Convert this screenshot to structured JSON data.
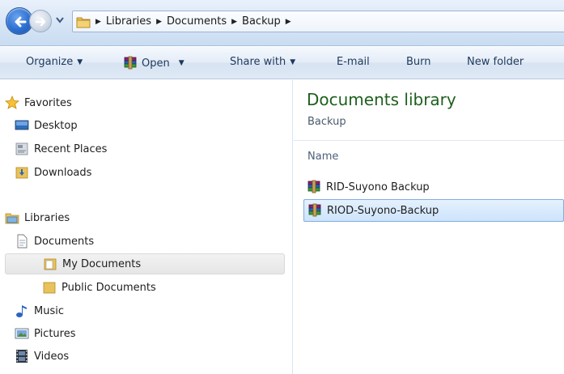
{
  "address": {
    "crumbs": [
      "Libraries",
      "Documents",
      "Backup"
    ]
  },
  "toolbar": {
    "organize": "Organize",
    "open": "Open",
    "share_with": "Share with",
    "email": "E-mail",
    "burn": "Burn",
    "new_folder": "New folder"
  },
  "nav": {
    "favorites": "Favorites",
    "desktop": "Desktop",
    "recent_places": "Recent Places",
    "downloads": "Downloads",
    "libraries": "Libraries",
    "documents": "Documents",
    "my_documents": "My Documents",
    "public_documents": "Public Documents",
    "music": "Music",
    "pictures": "Pictures",
    "videos": "Videos"
  },
  "content": {
    "title": "Documents library",
    "subtitle": "Backup",
    "column_name": "Name",
    "files": [
      "RID-Suyono Backup",
      "RIOD-Suyono-Backup"
    ]
  },
  "icons": {
    "back": "back-arrow-icon",
    "forward": "forward-arrow-icon",
    "folder": "folder-icon",
    "star": "star-icon",
    "desktop": "desktop-icon",
    "recent": "recent-places-icon",
    "downloads": "downloads-icon",
    "libraries": "libraries-icon",
    "document": "document-icon",
    "music": "music-note-icon",
    "pictures": "pictures-icon",
    "videos": "film-icon",
    "archive": "winrar-archive-icon"
  },
  "colors": {
    "library_title": "#1e5f1e",
    "selection": "#cde4fb",
    "toolbar_text": "#1e395b"
  }
}
